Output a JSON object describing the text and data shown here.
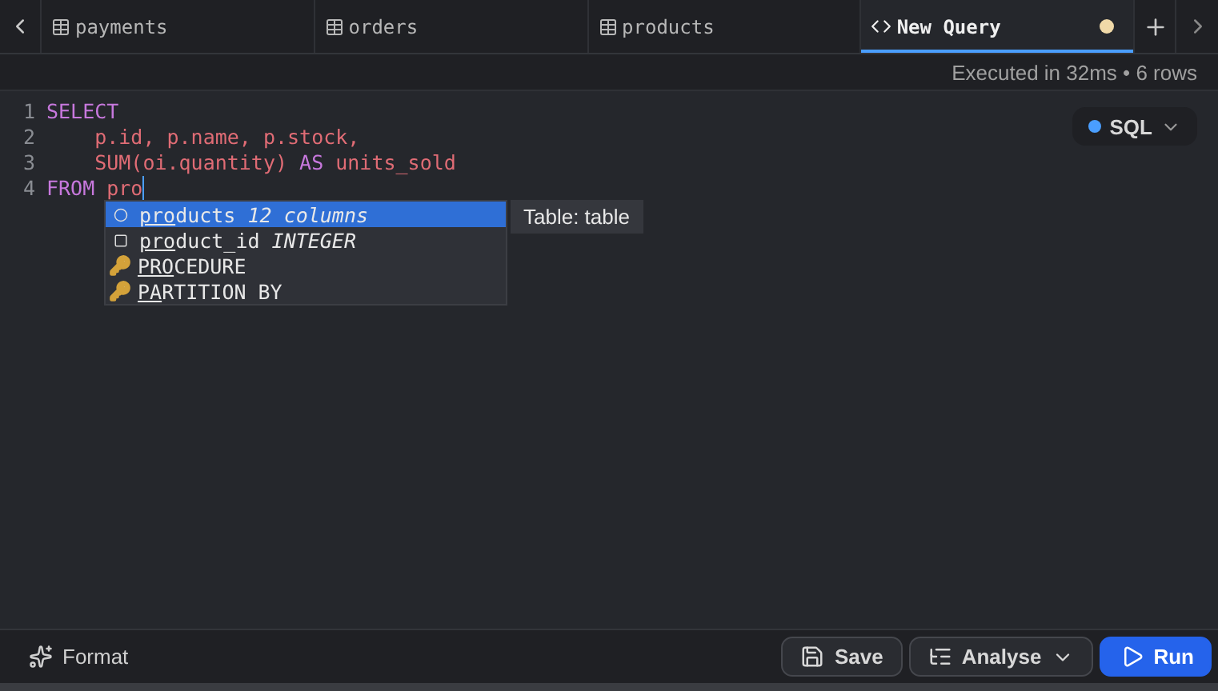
{
  "tabs": [
    {
      "label": "payments",
      "kind": "table",
      "selected": false,
      "unsaved": false
    },
    {
      "label": "orders",
      "kind": "table",
      "selected": false,
      "unsaved": false
    },
    {
      "label": "products",
      "kind": "table",
      "selected": false,
      "unsaved": false
    },
    {
      "label": "New Query",
      "kind": "query",
      "selected": true,
      "unsaved": true
    }
  ],
  "status": "Executed in 32ms • 6 rows",
  "language": {
    "label": "SQL",
    "color": "#4a9eff"
  },
  "code_lines": [
    {
      "number": "1",
      "tokens": [
        {
          "text": "SELECT",
          "kind": "keyword"
        }
      ]
    },
    {
      "number": "2",
      "tokens": [
        {
          "text": "    p.id, p.name, p.stock,",
          "kind": "ident"
        }
      ]
    },
    {
      "number": "3",
      "tokens": [
        {
          "text": "    SUM(oi.quantity) ",
          "kind": "ident"
        },
        {
          "text": "AS",
          "kind": "keyword"
        },
        {
          "text": " units_sold",
          "kind": "ident"
        }
      ]
    },
    {
      "number": "4",
      "tokens": [
        {
          "text": "FROM",
          "kind": "keyword"
        },
        {
          "text": " pro",
          "kind": "ident"
        }
      ],
      "cursor": true
    }
  ],
  "completions": [
    {
      "match": "pro",
      "rest": "ducts",
      "detail": "12 columns",
      "kind": "table",
      "selected": true
    },
    {
      "match": "pro",
      "rest": "duct_id",
      "detail": "INTEGER",
      "kind": "column",
      "selected": false
    },
    {
      "match": "PRO",
      "rest": "CEDURE",
      "kind": "keyword",
      "selected": false
    },
    {
      "match": "PA",
      "rest": "RTITION BY",
      "kind": "keyword",
      "selected": false
    }
  ],
  "completion_info": "Table: table",
  "footer": {
    "format": "Format",
    "save": "Save",
    "analyse": "Analyse",
    "run": "Run"
  }
}
